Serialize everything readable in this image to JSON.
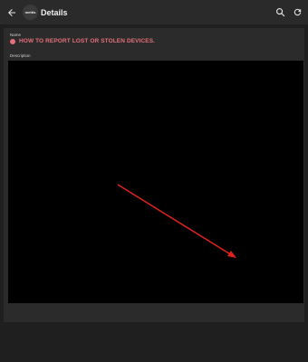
{
  "header": {
    "title": "Details",
    "logo_text": "mettis",
    "back_icon": "arrow-left-icon",
    "search_icon": "search-icon",
    "refresh_icon": "refresh-icon"
  },
  "record": {
    "name_label": "Name",
    "name_value": "HOW TO REPORT LOST OR STOLEN DEVICES.",
    "status_color": "#e46f7a",
    "description_label": "Description"
  },
  "media": {
    "background": "#000000",
    "arrow_color": "#e0241b",
    "arrow_icon": "red-arrow-annotation"
  }
}
